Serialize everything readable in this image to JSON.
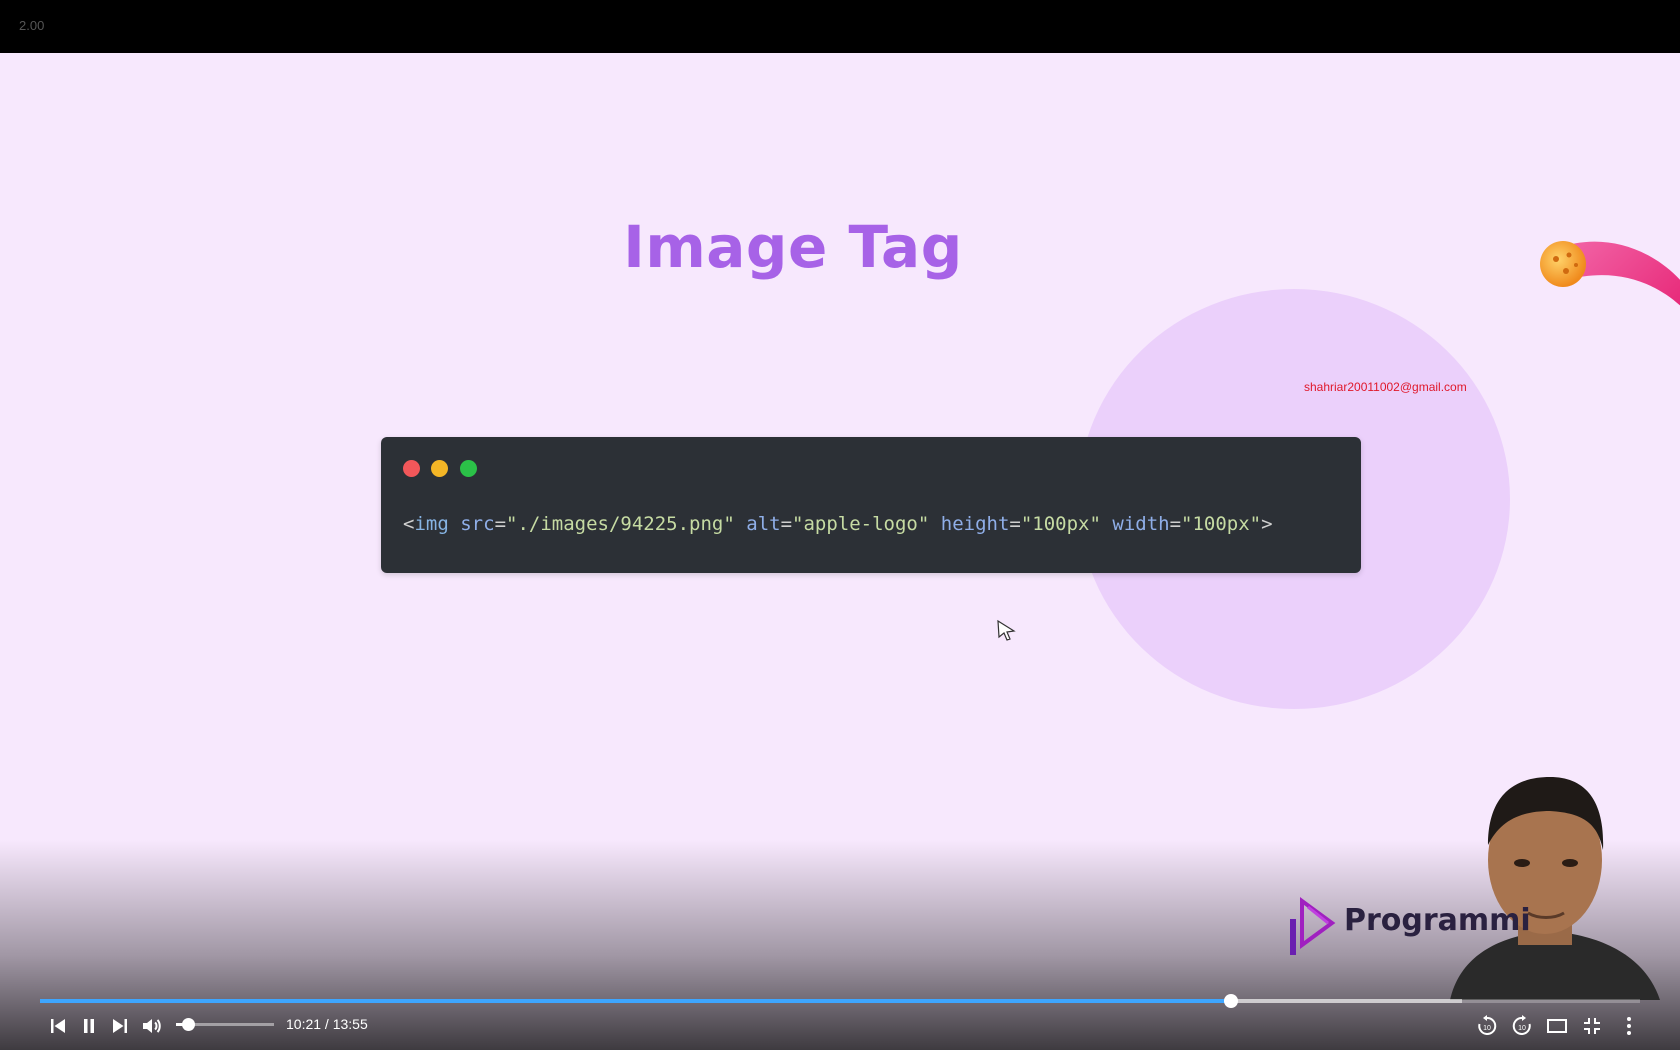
{
  "player": {
    "playback_speed": "2.00",
    "time_display": "10:21 / 13:55",
    "progress_fraction": 0.7445,
    "buffered_fraction": 0.889,
    "volume_fraction": 0.12,
    "accent_color": "#3ea6ff"
  },
  "slide": {
    "title": "Image Tag",
    "watermark_email": "shahriar20011002@gmail.com",
    "code_tokens": [
      {
        "text": "<",
        "kind": "punct"
      },
      {
        "text": "img",
        "kind": "tag"
      },
      {
        "text": " ",
        "kind": "punct"
      },
      {
        "text": "src",
        "kind": "attr"
      },
      {
        "text": "=",
        "kind": "punct"
      },
      {
        "text": "\"./images/94225.png\"",
        "kind": "str"
      },
      {
        "text": " ",
        "kind": "punct"
      },
      {
        "text": "alt",
        "kind": "attr"
      },
      {
        "text": "=",
        "kind": "punct"
      },
      {
        "text": "\"apple-logo\"",
        "kind": "str"
      },
      {
        "text": " ",
        "kind": "punct"
      },
      {
        "text": "height",
        "kind": "attr"
      },
      {
        "text": "=",
        "kind": "punct"
      },
      {
        "text": "\"100px\"",
        "kind": "str"
      },
      {
        "text": " ",
        "kind": "punct"
      },
      {
        "text": "width",
        "kind": "attr"
      },
      {
        "text": "=",
        "kind": "punct"
      },
      {
        "text": "\"100px\"",
        "kind": "str"
      },
      {
        "text": ">",
        "kind": "punct"
      }
    ],
    "brand_name": "Programmi"
  },
  "icons": {
    "previous": "skip-previous-icon",
    "pause": "pause-icon",
    "next": "skip-next-icon",
    "volume": "volume-icon",
    "rewind": "rewind-10-icon",
    "forward": "forward-10-icon",
    "theater": "theater-mode-icon",
    "exit_fullscreen": "exit-fullscreen-icon",
    "more": "more-vert-icon"
  }
}
